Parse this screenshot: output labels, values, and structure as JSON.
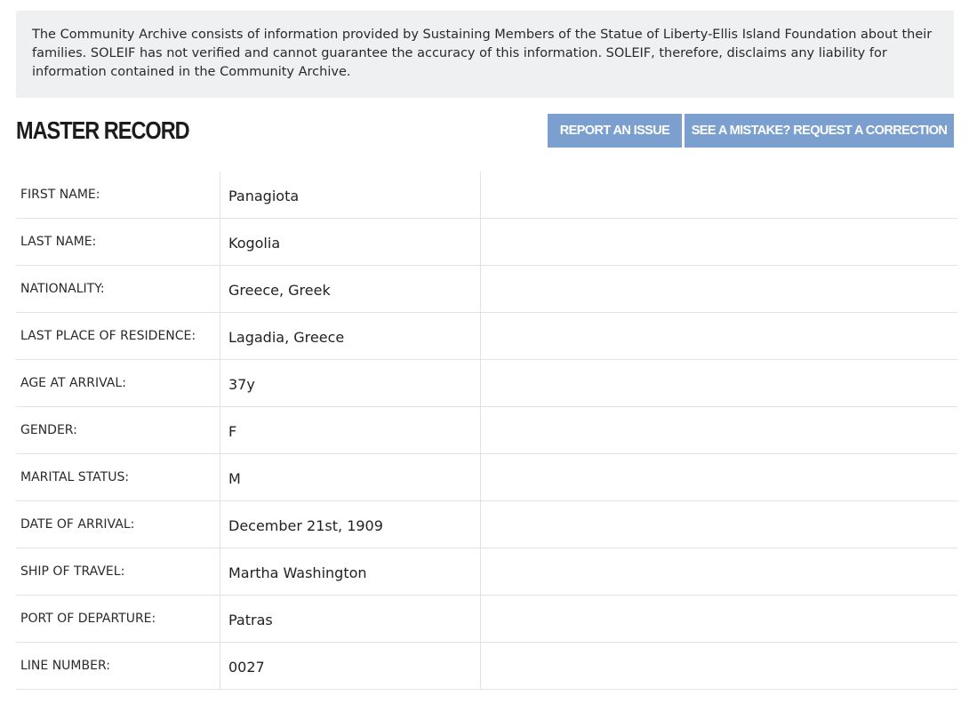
{
  "notice": {
    "text": "The Community Archive consists of information provided by Sustaining Members of the Statue of Liberty-Ellis Island Foundation about their families. SOLEIF has not verified and cannot guarantee the accuracy of this information. SOLEIF, therefore, disclaims any liability for information contained in the Community Archive."
  },
  "header": {
    "title": "MASTER RECORD",
    "report_label": "REPORT AN ISSUE",
    "correction_label": "SEE A MISTAKE? REQUEST A CORRECTION"
  },
  "record": {
    "rows": [
      {
        "label": "FIRST NAME:",
        "value": "Panagiota"
      },
      {
        "label": "LAST NAME:",
        "value": "Kogolia"
      },
      {
        "label": "NATIONALITY:",
        "value": "Greece, Greek"
      },
      {
        "label": "LAST PLACE OF RESIDENCE:",
        "value": "Lagadia, Greece"
      },
      {
        "label": "AGE AT ARRIVAL:",
        "value": "37y"
      },
      {
        "label": "GENDER:",
        "value": "F"
      },
      {
        "label": "MARITAL STATUS:",
        "value": "M"
      },
      {
        "label": "DATE OF ARRIVAL:",
        "value": "December 21st, 1909"
      },
      {
        "label": "SHIP OF TRAVEL:",
        "value": "Martha Washington"
      },
      {
        "label": "PORT OF DEPARTURE:",
        "value": "Patras"
      },
      {
        "label": "LINE NUMBER:",
        "value": "0027"
      }
    ]
  },
  "colors": {
    "button_bg": "#7ba0cf",
    "notice_bg": "#eef0f2"
  }
}
